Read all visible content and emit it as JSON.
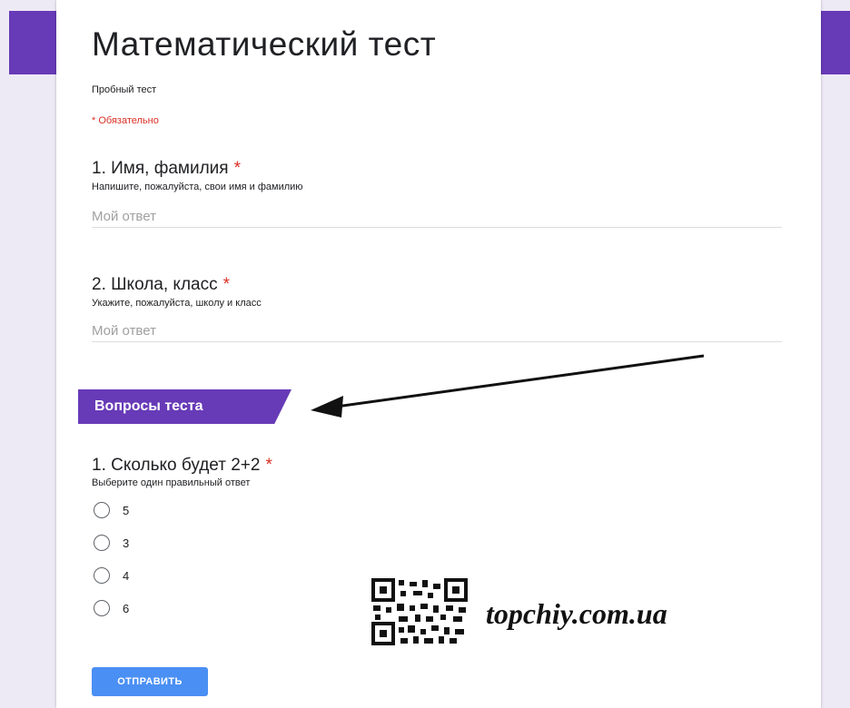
{
  "form": {
    "title": "Математический тест",
    "description": "Пробный тест",
    "required_note": "* Обязательно"
  },
  "questions": [
    {
      "title": "1. Имя, фамилия",
      "required": "*",
      "help": "Напишите, пожалуйста, свои имя и фамилию",
      "placeholder": "Мой ответ"
    },
    {
      "title": "2. Школа, класс",
      "required": "*",
      "help": "Укажите, пожалуйста, школу и класс",
      "placeholder": "Мой ответ"
    }
  ],
  "section": {
    "title": "Вопросы теста"
  },
  "quiz": {
    "title": "1. Сколько будет 2+2",
    "required": "*",
    "help": "Выберите один правильный ответ",
    "options": [
      "5",
      "3",
      "4",
      "6"
    ]
  },
  "submit_label": "ОТПРАВИТЬ",
  "watermark": {
    "text": "topchiy.com.ua"
  },
  "colors": {
    "accent": "#673ab7",
    "required": "#d93025",
    "button": "#4a8ff3",
    "background": "#ede9f5"
  }
}
